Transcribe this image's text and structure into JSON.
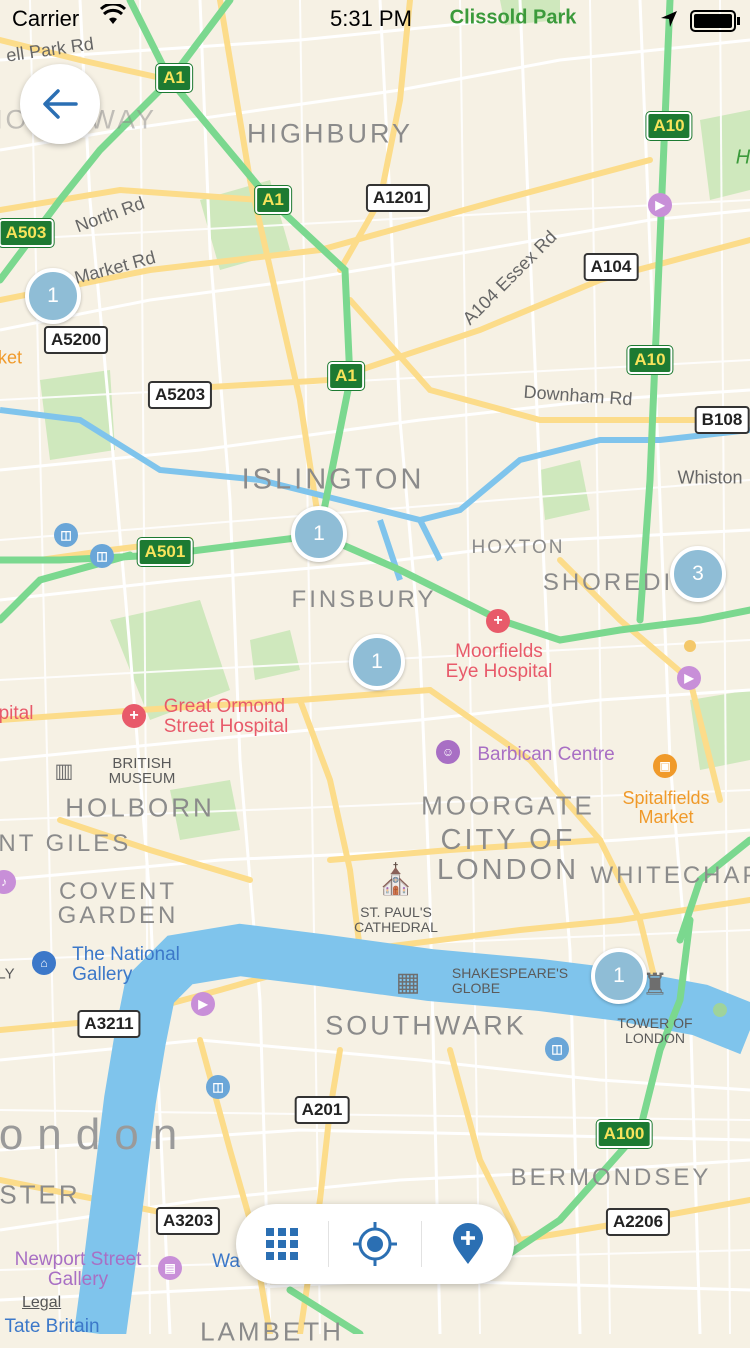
{
  "status_bar": {
    "carrier": "Carrier",
    "time": "5:31 PM"
  },
  "map": {
    "areas": {
      "highbury": "HIGHBURY",
      "holloway": "HOLLOWAY",
      "islington": "ISLINGTON",
      "finsbury": "FINSBURY",
      "hoxton": "HOXTON",
      "shoreditch": "SHOREDI",
      "holborn": "HOLBORN",
      "st_giles": "INT GILES",
      "covent_garden": "COVENT\nGARDEN",
      "moorgate": "MOORGATE",
      "city_of_london": "CITY OF\nLONDON",
      "whitechapel": "WHITECHAP",
      "southwark": "SOUTHWARK",
      "bermondsey": "BERMONDSEY",
      "london": "ondon",
      "pimlico": "STER",
      "lambeth": "LAMBETH"
    },
    "parks": {
      "clissold": "Clissold Park"
    },
    "streets": {
      "holloway_rd": "ell Park Rd",
      "north_rd": "North Rd",
      "market_rd": "Market Rd",
      "essex_rd": "A104 Essex Rd",
      "downham_rd": "Downham Rd",
      "whiston": "Whiston",
      "ket": "ket"
    },
    "shields_green": [
      "A1",
      "A1",
      "A1",
      "A503",
      "A501",
      "A10",
      "A10",
      "A100"
    ],
    "shields_white": [
      "A1201",
      "A104",
      "A5200",
      "A5203",
      "B108",
      "A3211",
      "A201",
      "A3203",
      "A2206"
    ],
    "pois": {
      "moorfields": "Moorfields\nEye Hospital",
      "great_ormond": "Great Ormond\nStreet Hospital",
      "british_museum": "BRITISH\nMUSEUM",
      "barbican": "Barbican Centre",
      "spitalfields": "Spitalfields\nMarket",
      "st_pauls": "ST. PAUL'S\nCATHEDRAL",
      "shakespeare": "SHAKESPEARE'S\nGLOBE",
      "tower": "TOWER OF\nLONDON",
      "national_gallery": "The National\nGallery",
      "newport_street": "Newport Street\nGallery",
      "tate_britain": "Tate Britain",
      "hospital_left": "pital",
      "gallery_left": "LY",
      "wa": "Wa",
      "h": "H"
    },
    "clusters": [
      "1",
      "1",
      "1",
      "3",
      "1"
    ]
  },
  "toolbar": {
    "grid_icon": "grid-icon",
    "locate_icon": "locate-icon",
    "add_pin_icon": "add-pin-icon"
  },
  "legal": "Legal",
  "colors": {
    "motorway": "#7bd88f",
    "primary": "#fcdc8a",
    "water": "#7fc4ec",
    "park": "#c8e5b5",
    "land": "#f6f1e4",
    "accent": "#2b6fb3",
    "cluster": "#8fbdd6"
  }
}
